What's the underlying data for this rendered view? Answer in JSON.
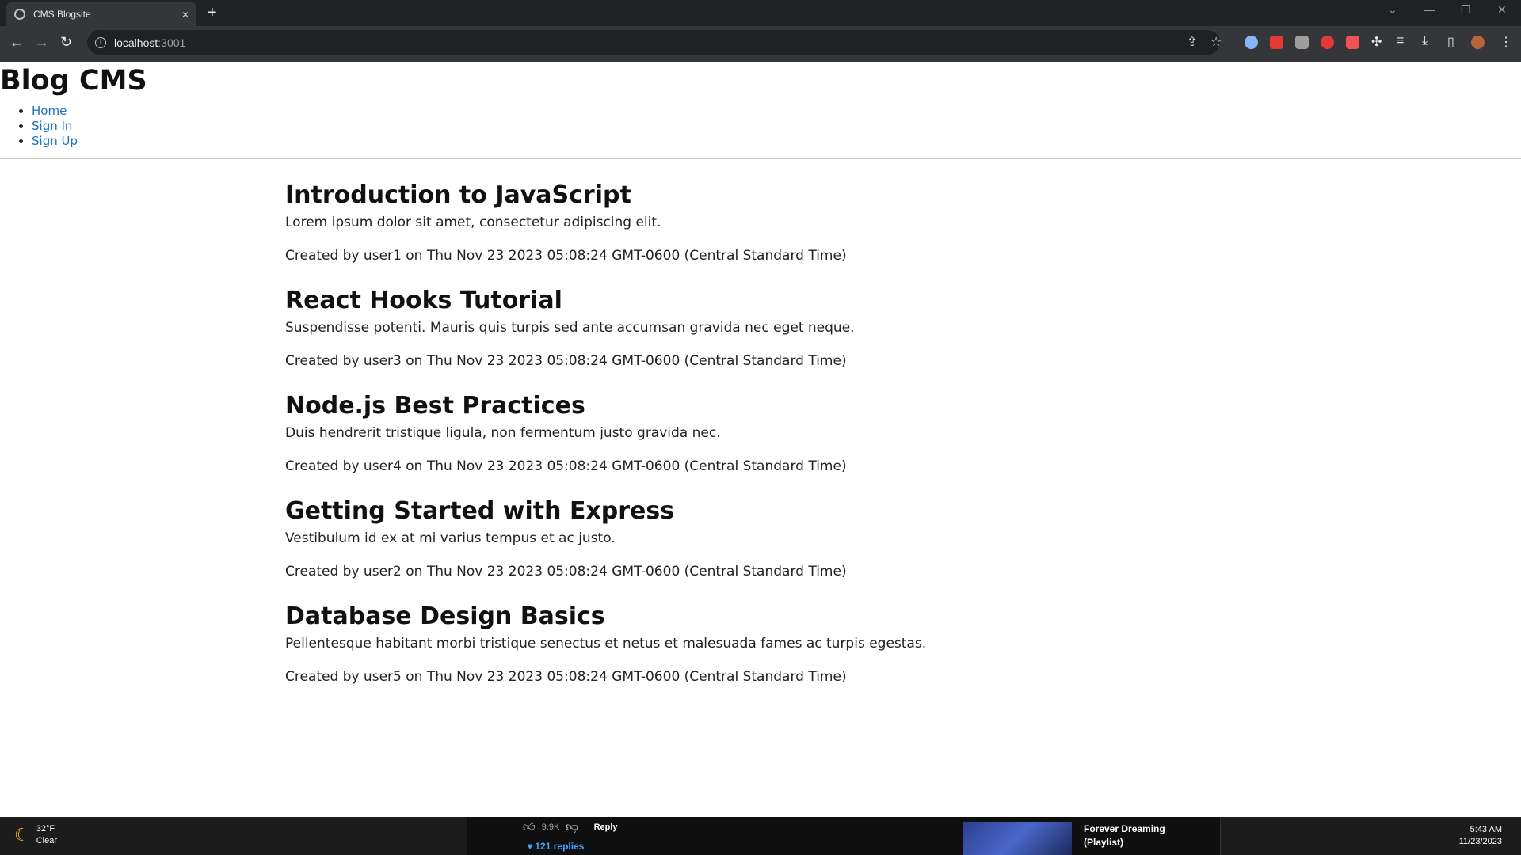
{
  "browser": {
    "tab_title": "CMS Blogsite",
    "tab_close": "×",
    "new_tab": "+",
    "url_host": "localhost",
    "url_port": ":3001"
  },
  "site": {
    "title": "Blog CMS",
    "nav": [
      "Home",
      "Sign In",
      "Sign Up"
    ]
  },
  "posts": [
    {
      "title": "Introduction to JavaScript",
      "body": "Lorem ipsum dolor sit amet, consectetur adipiscing elit.",
      "meta": "Created by user1 on Thu Nov 23 2023 05:08:24 GMT-0600 (Central Standard Time)"
    },
    {
      "title": "React Hooks Tutorial",
      "body": "Suspendisse potenti. Mauris quis turpis sed ante accumsan gravida nec eget neque.",
      "meta": "Created by user3 on Thu Nov 23 2023 05:08:24 GMT-0600 (Central Standard Time)"
    },
    {
      "title": "Node.js Best Practices",
      "body": "Duis hendrerit tristique ligula, non fermentum justo gravida nec.",
      "meta": "Created by user4 on Thu Nov 23 2023 05:08:24 GMT-0600 (Central Standard Time)"
    },
    {
      "title": "Getting Started with Express",
      "body": "Vestibulum id ex at mi varius tempus et ac justo.",
      "meta": "Created by user2 on Thu Nov 23 2023 05:08:24 GMT-0600 (Central Standard Time)"
    },
    {
      "title": "Database Design Basics",
      "body": "Pellentesque habitant morbi tristique senectus et netus et malesuada fames ac turpis egestas.",
      "meta": "Created by user5 on Thu Nov 23 2023 05:08:24 GMT-0600 (Central Standard Time)"
    }
  ],
  "taskbar": {
    "temperature": "32°F",
    "condition": "Clear",
    "like_count": "9.9K",
    "reply_label": "Reply",
    "replies": "121 replies",
    "playlist_line1": "Forever Dreaming",
    "playlist_line2": "(Playlist)",
    "time": "5:43 AM",
    "date": "11/23/2023"
  },
  "colors": {
    "link": "#1a73c0",
    "chrome_bg": "#35363a",
    "taskbar_bg": "#1c1c1c"
  }
}
